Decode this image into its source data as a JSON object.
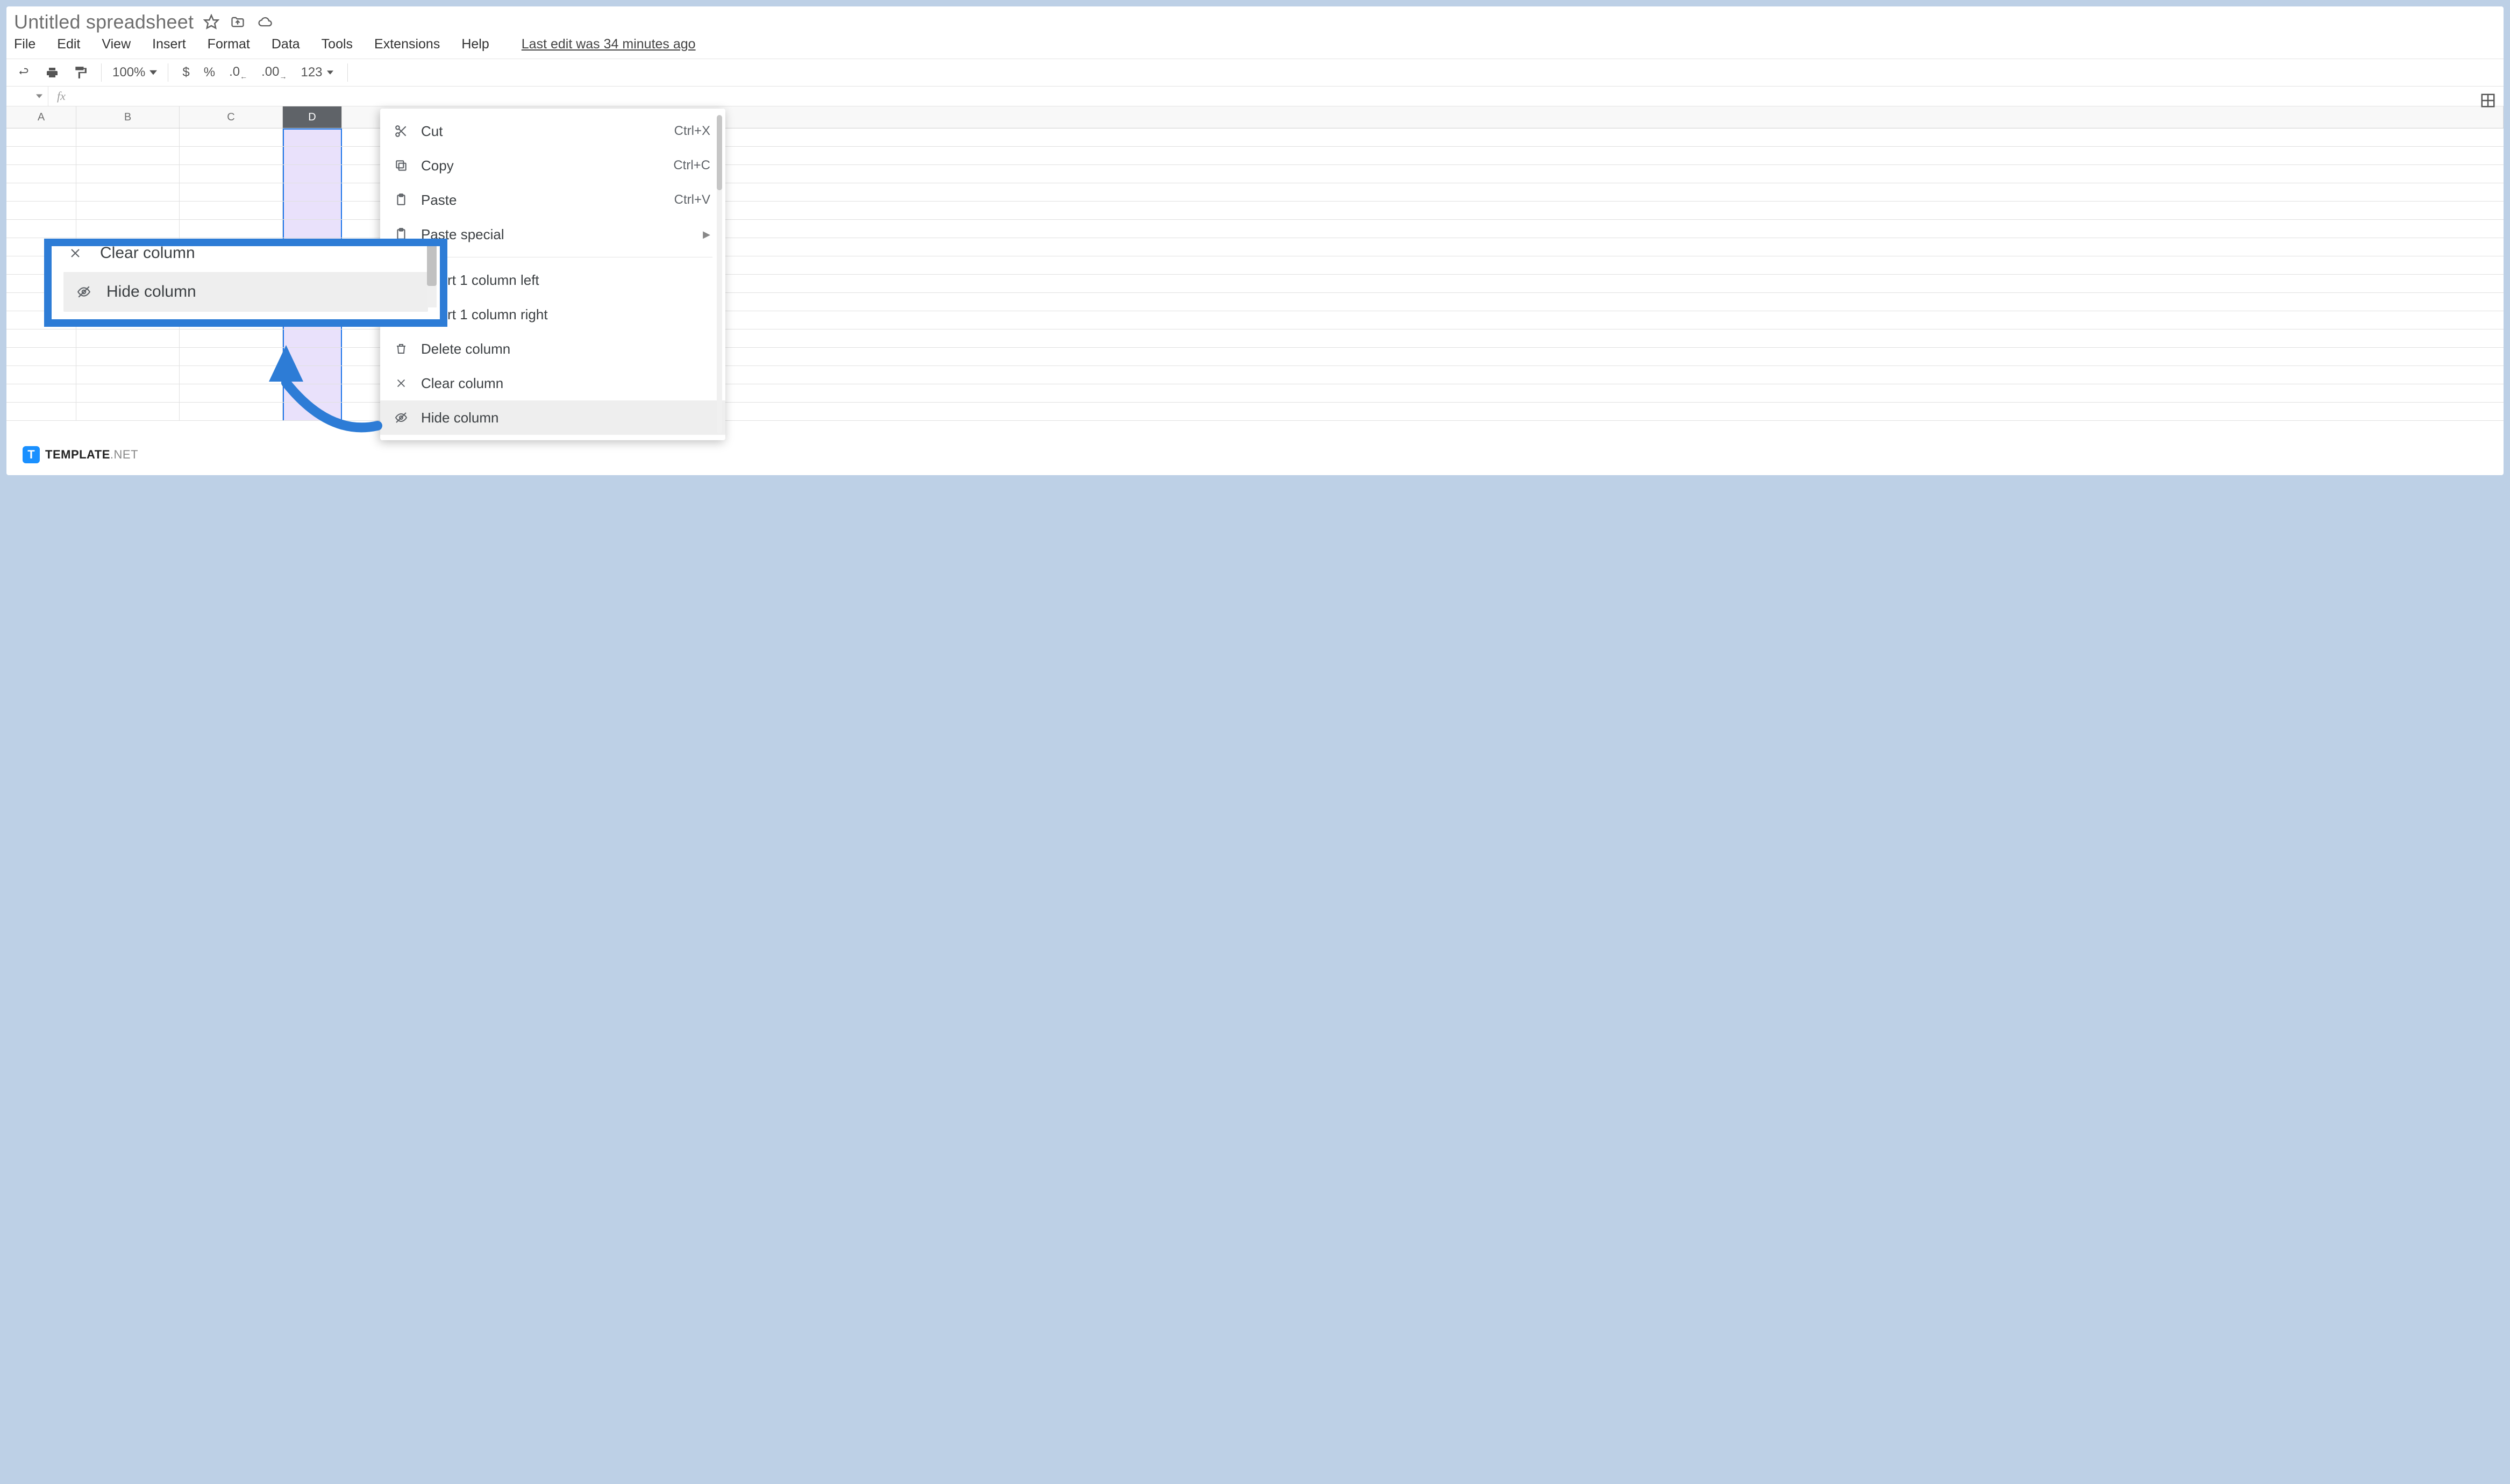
{
  "doc": {
    "title": "Untitled spreadsheet"
  },
  "menus": {
    "file": "File",
    "edit": "Edit",
    "view": "View",
    "insert": "Insert",
    "format": "Format",
    "data": "Data",
    "tools": "Tools",
    "extensions": "Extensions",
    "help": "Help",
    "last_edit": "Last edit was 34 minutes ago"
  },
  "toolbar": {
    "zoom": "100%",
    "currency": "$",
    "percent": "%",
    "dec_dec": ".0",
    "inc_dec": ".00",
    "numformat": "123"
  },
  "columns": {
    "a": "A",
    "b": "B",
    "c": "C",
    "d": "D"
  },
  "context": {
    "cut": "Cut",
    "cut_sc": "Ctrl+X",
    "copy": "Copy",
    "copy_sc": "Ctrl+C",
    "paste": "Paste",
    "paste_sc": "Ctrl+V",
    "paste_special": "Paste special",
    "insert_left": "Insert 1 column left",
    "insert_right": "Insert 1 column right",
    "delete_col": "Delete column",
    "clear_col": "Clear column",
    "hide_col": "Hide column"
  },
  "callout": {
    "clear_col": "Clear column",
    "hide_col": "Hide column"
  },
  "brand": {
    "name": "TEMPLATE",
    "suffix": ".NET",
    "badge": "T"
  }
}
